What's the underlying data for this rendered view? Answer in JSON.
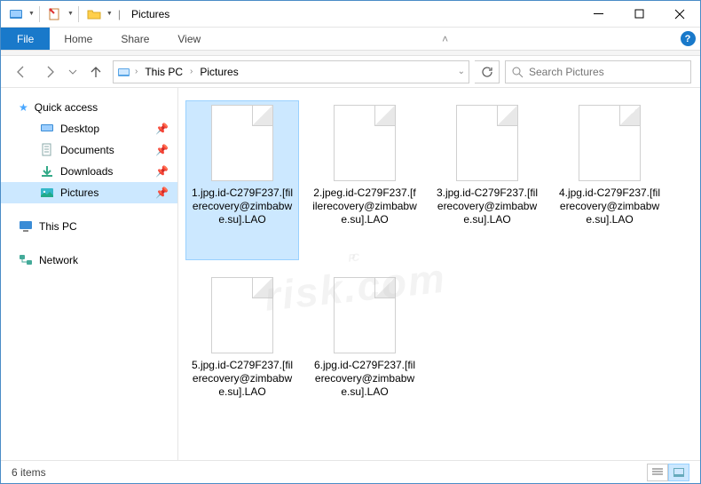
{
  "titlebar": {
    "title": "Pictures",
    "pipe": "|"
  },
  "ribbon": {
    "file": "File",
    "tabs": [
      "Home",
      "Share",
      "View"
    ]
  },
  "nav": {
    "breadcrumb": [
      "This PC",
      "Pictures"
    ],
    "search_placeholder": "Search Pictures"
  },
  "sidebar": {
    "quick": "Quick access",
    "items": [
      {
        "label": "Desktop",
        "pinned": true
      },
      {
        "label": "Documents",
        "pinned": true
      },
      {
        "label": "Downloads",
        "pinned": true
      },
      {
        "label": "Pictures",
        "pinned": true,
        "selected": true
      }
    ],
    "thispc": "This PC",
    "network": "Network"
  },
  "files": [
    {
      "name": "1.jpg.id-C279F237.[filerecovery@zimbabwe.su].LAO",
      "selected": true
    },
    {
      "name": "2.jpeg.id-C279F237.[filerecovery@zimbabwe.su].LAO"
    },
    {
      "name": "3.jpg.id-C279F237.[filerecovery@zimbabwe.su].LAO"
    },
    {
      "name": "4.jpg.id-C279F237.[filerecovery@zimbabwe.su].LAO"
    },
    {
      "name": "5.jpg.id-C279F237.[filerecovery@zimbabwe.su].LAO"
    },
    {
      "name": "6.jpg.id-C279F237.[filerecovery@zimbabwe.su].LAO"
    }
  ],
  "status": {
    "text": "6 items"
  },
  "watermark": {
    "line1": "PC",
    "line2": "risk.com"
  }
}
